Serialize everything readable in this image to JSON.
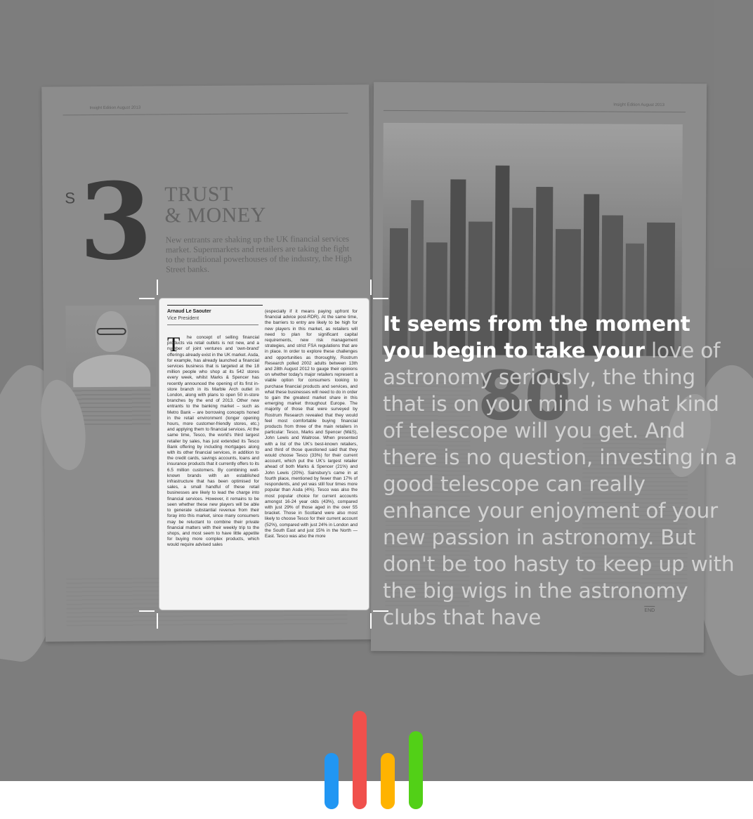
{
  "magazine": {
    "left_running_head": "Insight Edition  August 2013",
    "right_running_head": "Insight Edition  August 2013",
    "section_letter": "S",
    "section_number": "3",
    "title_line1": "TRUST",
    "title_line2": "& MONEY",
    "standfirst": "New entrants are shaking up the UK financial services market. Supermarkets and retailers are taking the fight to the traditional powerhouses of the industry, the High Street banks.",
    "pull_number": "80",
    "end_mark": "END"
  },
  "scanned_card": {
    "author_name": "Arnaud Le Saouter",
    "author_role": "Vice President",
    "dropcap": "T",
    "column_1": "he concept of selling financial products via retail outlets is not new, and a number of joint ventures and 'own-brand' offerings already exist in the UK market. Asda, for example, has already launched a financial services business that is targeted at the 18 million people who shop at its 542 stores every week, whilst Marks & Spencer has recently announced the opening of its first in-store branch in its Marble Arch outlet in London, along with plans to open 50 in-store branches by the end of 2013. Other new entrants to the banking market – such as Metro Bank – are borrowing concepts honed in the retail environment (longer opening hours, more customer-friendly stores, etc.) and applying them to financial services. At the same time, Tesco, the world's third largest retailer by sales, has just extended its Tesco Bank offering by including mortgages along with its other financial services, in addition to the credit cards, savings accounts, loans and insurance products that it currently offers to its 6.5 million customers. By combining well-known brands with an established infrastructure that has been optimised for sales, a small handful of these retail businesses are likely to lead the charge into financial services. However, it remains to be seen whether these new players will be able to generate substantial revenue from their foray into this market, since many consumers may be reluctant to combine their private financial matters with their weekly trip to the shops, and most seem to have little appetite for buying more complex products, which would require advised sales",
    "column_2": "(especially if it means paying upfront for financial advice post-RDR). At the same time, the barriers to entry are likely to be high for new players in this market, as retailers will need to plan for significant capital requirements, new risk management strategies, and strict FSA regulations that are in place. In order to explore these challenges and opportunities as thoroughly, Rostrum Research polled 2002 adults between 13th and 28th August 2012 to gauge their opinions on whether today's major retailers represent a viable option for consumers looking to purchase financial products and services, and what these businesses will need to do in order to gain the greatest market share in this emerging market throughout Europe. The majority of those that were surveyed by Rostrum Research revealed that they would feel most comfortable buying financial products from three of the main retailers in particular: Tesco, Marks and Spencer (M&S), John Lewis and Waitrose. When presented with a list of the UK's best-known retailers, and third of those questioned said that they would choose Tesco (33%) for their current account, which put the UK's largest retailer ahead of both Marks & Spencer (21%) and John Lewis (20%). Sainsbury's came in at fourth place, mentioned by fewer than 17% of respondents, and yet was still four times more popular than Asda (4%). Tesco was also the most popular choice for current accounts amongst 16-24 year olds (43%), compared with just 29% of those aged in the over 55 bracket. Those in Scotland were also most likely to choose Tesco for their current account (52%), compared with just 24% in London and the South East and just 15% in the North — East. Tesco was also the more"
  },
  "reading": {
    "read_text": "It seems from the moment you begin to take your",
    "unread_text": " love of astronomy seriously, the thing that is on your mind is what kind of telescope will you get. And there is no question, investing in a good telescope can really enhance your enjoyment of your new passion in astronomy. But don't be too hasty to keep up with the big wigs in the astronomy clubs that have"
  },
  "voice_indicator": {
    "icon": "voice-level-bars-icon",
    "bars": [
      {
        "color": "#2196F3",
        "level": 0.57
      },
      {
        "color": "#F0504C",
        "level": 1.0
      },
      {
        "color": "#FFB300",
        "level": 0.57
      },
      {
        "color": "#52D017",
        "level": 0.79
      }
    ]
  }
}
